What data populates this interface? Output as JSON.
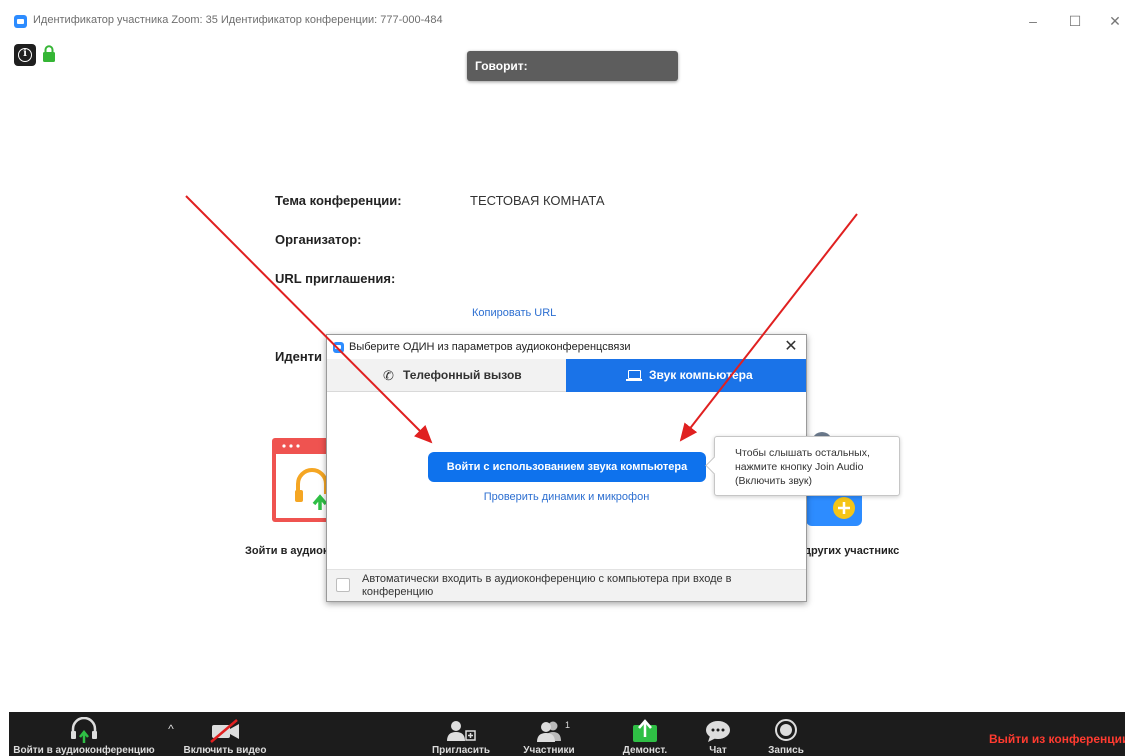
{
  "window": {
    "title": "Идентификатор участника Zoom: 35   Идентификатор конференции: 777-000-484",
    "min_glyph": "–",
    "max_glyph": "☐",
    "close_glyph": "✕"
  },
  "speaking_label": "Говорит:",
  "meeting_info": {
    "topic_label": "Тема конференции:",
    "topic_value": "ТЕСТОВАЯ КОМНАТА",
    "host_label": "Организатор:",
    "url_label": "URL приглашения:",
    "copy_url": "Копировать URL",
    "id_label_partial": "Иденти"
  },
  "background_options": {
    "join_audio_partial": "Зойти в аудиок",
    "invite_partial": "других участникс"
  },
  "dialog": {
    "title": "Выберите ОДИН из параметров аудиоконференцсвязи",
    "close_glyph": "✕",
    "tabs": [
      {
        "label": "Телефонный вызов",
        "icon": "phone-icon",
        "active": false
      },
      {
        "label": "Звук компьютера",
        "icon": "laptop-icon",
        "active": true
      }
    ],
    "join_button": "Войти с использованием звука компьютера",
    "test_link": "Проверить динамик и микрофон",
    "auto_join_checked": false,
    "auto_join_label": "Автоматически входить в аудиоконференцию с компьютера при входе в конференцию"
  },
  "tooltip": "Чтобы слышать остальных, нажмите кнопку Join Audio (Включить звук)",
  "toolbar": {
    "items": [
      {
        "label": "Войти в аудиоконференцию",
        "icon": "headphones-icon"
      },
      {
        "label": "Включить видео",
        "icon": "video-off-icon"
      },
      {
        "label": "Пригласить",
        "icon": "invite-icon"
      },
      {
        "label": "Участники",
        "icon": "participants-icon",
        "badge": "1"
      },
      {
        "label": "Демонст.",
        "icon": "share-screen-icon"
      },
      {
        "label": "Чат",
        "icon": "chat-icon"
      },
      {
        "label": "Запись",
        "icon": "record-icon"
      }
    ],
    "caret_glyph": "^",
    "leave": "Выйти из конференции"
  },
  "colors": {
    "accent": "#0e72ed",
    "tab_active": "#1a73e8",
    "arrow": "#e02020",
    "toolbar_bg": "#1c1c1c",
    "leave": "#ff3b30",
    "share_green": "#2fbf45"
  }
}
